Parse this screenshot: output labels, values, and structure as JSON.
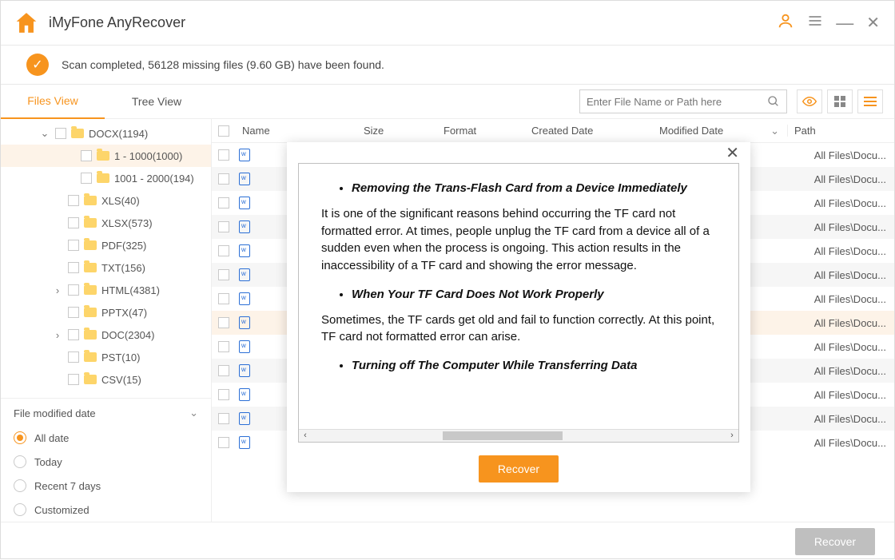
{
  "app": {
    "title": "iMyFone AnyRecover"
  },
  "status": {
    "text": "Scan completed, 56128 missing files (9.60 GB) have been found."
  },
  "tabs": {
    "files": "Files View",
    "tree": "Tree View"
  },
  "search": {
    "placeholder": "Enter File Name or Path here"
  },
  "columns": {
    "name": "Name",
    "size": "Size",
    "format": "Format",
    "created": "Created Date",
    "modified": "Modified Date",
    "path": "Path"
  },
  "tree": [
    {
      "label": "DOCX(1194)",
      "indent": 48,
      "chev": "⌄",
      "sel": false
    },
    {
      "label": "1 - 1000(1000)",
      "indent": 80,
      "chev": "",
      "sel": true
    },
    {
      "label": "1001 - 2000(194)",
      "indent": 80,
      "chev": "",
      "sel": false
    },
    {
      "label": "XLS(40)",
      "indent": 64,
      "chev": "",
      "sel": false
    },
    {
      "label": "XLSX(573)",
      "indent": 64,
      "chev": "",
      "sel": false
    },
    {
      "label": "PDF(325)",
      "indent": 64,
      "chev": "",
      "sel": false
    },
    {
      "label": "TXT(156)",
      "indent": 64,
      "chev": "",
      "sel": false
    },
    {
      "label": "HTML(4381)",
      "indent": 64,
      "chev": "›",
      "sel": false
    },
    {
      "label": "PPTX(47)",
      "indent": 64,
      "chev": "",
      "sel": false
    },
    {
      "label": "DOC(2304)",
      "indent": 64,
      "chev": "›",
      "sel": false
    },
    {
      "label": "PST(10)",
      "indent": 64,
      "chev": "",
      "sel": false
    },
    {
      "label": "CSV(15)",
      "indent": 64,
      "chev": "",
      "sel": false
    }
  ],
  "filter": {
    "header": "File modified date",
    "options": [
      "All date",
      "Today",
      "Recent 7 days",
      "Customized"
    ],
    "selected": 0
  },
  "path_text": "All Files\\Docu...",
  "rows_count": 13,
  "highlight_rows": [
    7
  ],
  "modal": {
    "bullets": [
      "Removing the Trans-Flash Card from a Device Immediately",
      "When Your TF Card Does Not Work Properly",
      "Turning off The Computer While Transferring Data"
    ],
    "paras": [
      "It is one of the significant reasons behind occurring the TF card not formatted error. At times, people unplug the TF card from a device all of a sudden even when the process is ongoing. This action results in the inaccessibility of a TF card and showing the error message.",
      "Sometimes, the TF cards get old and fail to function correctly. At this point, TF card not formatted error can arise."
    ],
    "button": "Recover"
  },
  "footer": {
    "button": "Recover"
  }
}
